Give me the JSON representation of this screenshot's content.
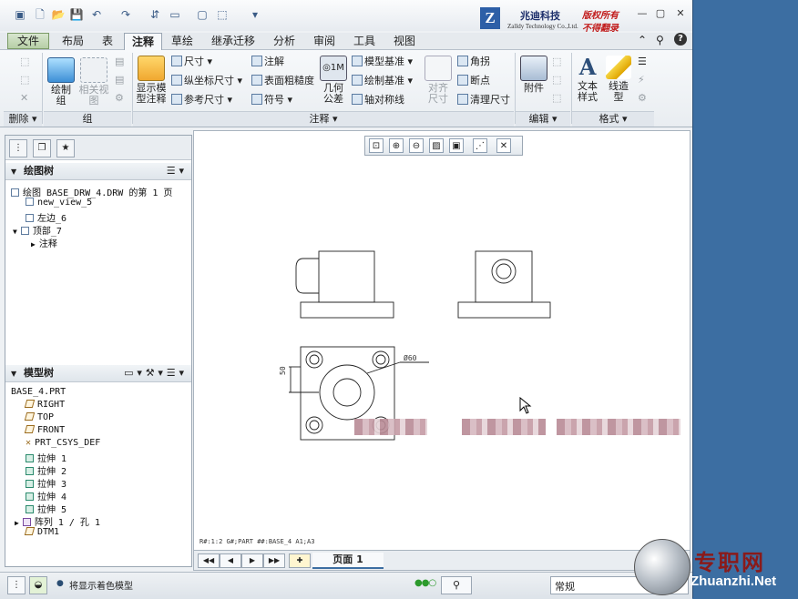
{
  "logo": {
    "mark": "Z",
    "company_cn": "兆迪科技",
    "company_en": "Zalldy Technology Co.,Ltd.",
    "copyright_line1": "版权所有",
    "copyright_line2": "不得翻录"
  },
  "tabs": [
    "文件",
    "布局",
    "表",
    "注释",
    "草绘",
    "继承迁移",
    "分析",
    "审阅",
    "工具",
    "视图"
  ],
  "active_tab": "注释",
  "ribbon": {
    "delete_group": "删除",
    "group_group": "组",
    "group_buttons": {
      "draw_group": "绘制\n组",
      "related_view": "相关视\n图"
    },
    "show_model_annotations": "显示模\n型注释",
    "dimension": "尺寸",
    "ordinate_dimension": "纵坐标尺寸",
    "reference_dimension": "参考尺寸",
    "note": "注解",
    "surface_finish": "表面粗糙度",
    "symbol": "符号",
    "geometric_tolerance": "几何\n公差",
    "model_datum": "模型基准",
    "draw_datum": "绘制基准",
    "axis_symmetry": "轴对称线",
    "align_dimension": "对齐\n尺寸",
    "corner": "角拐",
    "breakpoint": "断点",
    "cleanup_dimension": "清理尺寸",
    "annotation_group": "注释",
    "attachment": "附件",
    "edit_group": "编辑",
    "text_style": "文本\n样式",
    "line_style": "线造\n型",
    "format_group": "格式"
  },
  "drawing_tree": {
    "title": "绘图树",
    "items": [
      "绘图 BASE_DRW_4.DRW 的第 1 页",
      "new_view_5",
      "左边_6",
      "顶部_7",
      "注释"
    ]
  },
  "model_tree": {
    "title": "模型树",
    "root": "BASE_4.PRT",
    "items": [
      "RIGHT",
      "TOP",
      "FRONT",
      "PRT_CSYS_DEF",
      "拉伸 1",
      "拉伸 2",
      "拉伸 3",
      "拉伸 4",
      "拉伸 5",
      "阵列 1 / 孔 1",
      "DTM1"
    ]
  },
  "drawing": {
    "dim_vertical": "50",
    "dim_diameter": "Ø60",
    "status_string": "R#:1:2    G#;PART  ##:BASE_4  A1;A3"
  },
  "page_bar": {
    "page_label": "页面 1"
  },
  "status_bar": {
    "message": "将显示着色模型",
    "filter_value": "常规"
  },
  "watermark": {
    "cn": "专职网",
    "en": "Zhuanzhi.Net"
  }
}
